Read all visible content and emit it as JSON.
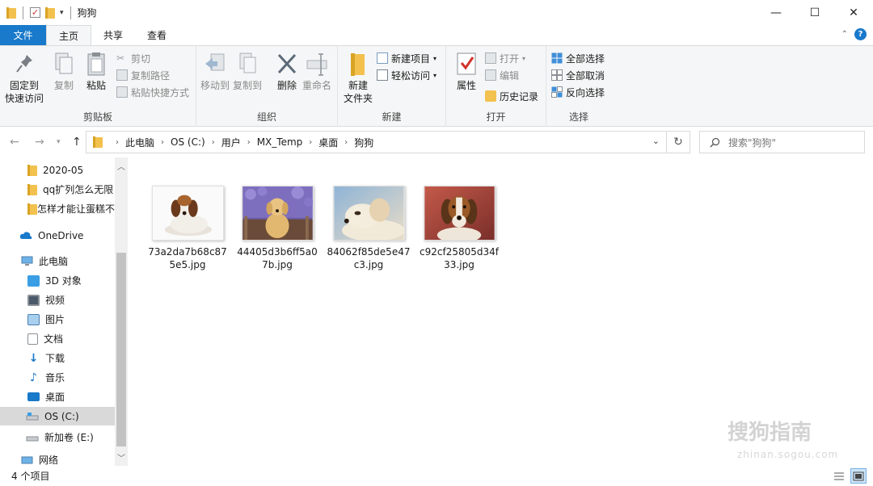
{
  "window": {
    "title": "狗狗",
    "controls": {
      "minimize": "—",
      "maximize": "☐",
      "close": "✕"
    }
  },
  "ribbon_tabs": [
    {
      "label": "文件"
    },
    {
      "label": "主页"
    },
    {
      "label": "共享"
    },
    {
      "label": "查看"
    }
  ],
  "ribbon": {
    "clipboard": {
      "pin_line1": "固定到",
      "pin_line2": "快速访问",
      "copy": "复制",
      "paste": "粘贴",
      "cut": "剪切",
      "copy_path": "复制路径",
      "paste_shortcut": "粘贴快捷方式",
      "label": "剪贴板"
    },
    "organize": {
      "move_to": "移动到",
      "copy_to": "复制到",
      "delete": "删除",
      "rename": "重命名",
      "label": "组织"
    },
    "new": {
      "new_folder_line1": "新建",
      "new_folder_line2": "文件夹",
      "new_item": "新建项目",
      "easy_access": "轻松访问",
      "label": "新建"
    },
    "open": {
      "properties": "属性",
      "open": "打开",
      "edit": "编辑",
      "history": "历史记录",
      "label": "打开"
    },
    "select": {
      "select_all": "全部选择",
      "select_none": "全部取消",
      "invert": "反向选择",
      "label": "选择"
    }
  },
  "address": {
    "breadcrumbs": [
      "此电脑",
      "OS (C:)",
      "用户",
      "MX_Temp",
      "桌面",
      "狗狗"
    ],
    "search_placeholder": "搜索\"狗狗\""
  },
  "nav_pane": {
    "items": [
      {
        "label": "2020-05",
        "icon": "folder-icon"
      },
      {
        "label": "qq扩列怎么无限",
        "icon": "folder-icon"
      },
      {
        "label": "怎样才能让蛋糕不",
        "icon": "folder-icon"
      },
      {
        "label": "OneDrive",
        "icon": "cloud-icon"
      },
      {
        "label": "此电脑",
        "icon": "computer-icon"
      },
      {
        "label": "3D 对象",
        "icon": "cube-icon"
      },
      {
        "label": "视频",
        "icon": "video-icon"
      },
      {
        "label": "图片",
        "icon": "picture-icon"
      },
      {
        "label": "文档",
        "icon": "document-icon"
      },
      {
        "label": "下载",
        "icon": "download-icon"
      },
      {
        "label": "音乐",
        "icon": "music-icon"
      },
      {
        "label": "桌面",
        "icon": "desktop-icon"
      },
      {
        "label": "OS (C:)",
        "icon": "drive-icon",
        "selected": true
      },
      {
        "label": "新加卷 (E:)",
        "icon": "drive-icon"
      },
      {
        "label": "网络",
        "icon": "network-icon"
      }
    ]
  },
  "files": [
    {
      "name": "73a2da7b68c875e5.jpg"
    },
    {
      "name": "44405d3b6ff5a07b.jpg"
    },
    {
      "name": "84062f85de5e47c3.jpg"
    },
    {
      "name": "c92cf25805d34f33.jpg"
    }
  ],
  "status": {
    "item_count": "4 个项目"
  },
  "watermark": {
    "text": "搜狗指南",
    "sub": "zhinan.sogou.com"
  },
  "colors": {
    "accent": "#1979ca",
    "folder": "#f2c14e",
    "selected_bg": "#d9d9d9"
  }
}
